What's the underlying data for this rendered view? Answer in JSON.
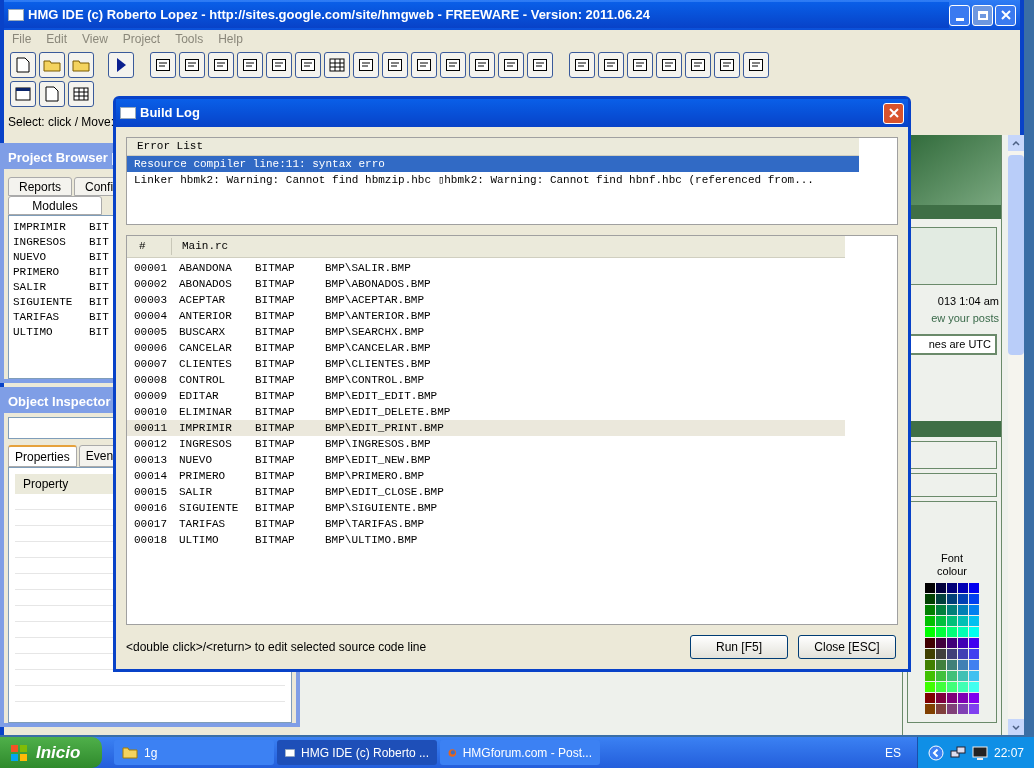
{
  "ide": {
    "title": "HMG IDE (c) Roberto Lopez - http://sites.google.com/site/hmgweb - FREEWARE - Version: 2011.06.24",
    "menu": [
      "File",
      "Edit",
      "View",
      "Project",
      "Tools",
      "Help"
    ],
    "status": "Select: click / Move:"
  },
  "project_browser": {
    "title": "Project Browser |",
    "tabs": [
      {
        "label": "Reports",
        "selected": false
      },
      {
        "label": "Confi",
        "selected": false
      },
      {
        "label": "Modules",
        "selected": true
      }
    ],
    "items": [
      {
        "name": "IMPRIMIR",
        "type": "BIT"
      },
      {
        "name": "INGRESOS",
        "type": "BIT"
      },
      {
        "name": "NUEVO",
        "type": "BIT"
      },
      {
        "name": "PRIMERO",
        "type": "BIT"
      },
      {
        "name": "SALIR",
        "type": "BIT"
      },
      {
        "name": "SIGUIENTE",
        "type": "BIT"
      },
      {
        "name": "TARIFAS",
        "type": "BIT"
      },
      {
        "name": "ULTIMO",
        "type": "BIT"
      }
    ]
  },
  "object_inspector": {
    "title": "Object Inspector",
    "tabs": [
      {
        "label": "Properties",
        "selected": true
      },
      {
        "label": "Even",
        "selected": false
      }
    ],
    "columns": [
      "Property"
    ]
  },
  "browser": {
    "date": "013 1:04 am",
    "link": "ew your posts",
    "timezone": "nes are UTC",
    "font_label": "Font colour"
  },
  "build_log": {
    "title": "Build Log",
    "error_list": {
      "header": "Error List",
      "rows": [
        {
          "text": "Resource compiler line:11: syntax erro",
          "selected": true
        },
        {
          "text": "Linker hbmk2: Warning: Cannot find hbmzip.hbc ▯hbmk2: Warning: Cannot find hbnf.hbc (referenced from...",
          "selected": false
        }
      ]
    },
    "source": {
      "columns": [
        "#",
        "Main.rc"
      ],
      "rows": [
        {
          "line": "00001",
          "name": "ABANDONA",
          "type": "BITMAP",
          "path": "BMP\\SALIR.BMP",
          "selected": false
        },
        {
          "line": "00002",
          "name": "ABONADOS",
          "type": "BITMAP",
          "path": "BMP\\ABONADOS.BMP",
          "selected": false
        },
        {
          "line": "00003",
          "name": "ACEPTAR",
          "type": "BITMAP",
          "path": "BMP\\ACEPTAR.BMP",
          "selected": false
        },
        {
          "line": "00004",
          "name": "ANTERIOR",
          "type": "BITMAP",
          "path": "BMP\\ANTERIOR.BMP",
          "selected": false
        },
        {
          "line": "00005",
          "name": "BUSCARX",
          "type": "BITMAP",
          "path": "BMP\\SEARCHX.BMP",
          "selected": false
        },
        {
          "line": "00006",
          "name": "CANCELAR",
          "type": "BITMAP",
          "path": "BMP\\CANCELAR.BMP",
          "selected": false
        },
        {
          "line": "00007",
          "name": "CLIENTES",
          "type": "BITMAP",
          "path": "BMP\\CLIENTES.BMP",
          "selected": false
        },
        {
          "line": "00008",
          "name": "CONTROL",
          "type": "BITMAP",
          "path": "BMP\\CONTROL.BMP",
          "selected": false
        },
        {
          "line": "00009",
          "name": "EDITAR",
          "type": "BITMAP",
          "path": "BMP\\EDIT_EDIT.BMP",
          "selected": false
        },
        {
          "line": "00010",
          "name": "ELIMINAR",
          "type": "BITMAP",
          "path": "BMP\\EDIT_DELETE.BMP",
          "selected": false
        },
        {
          "line": "00011",
          "name": "IMPRIMIR",
          "type": "BITMAP",
          "path": "BMP\\EDIT_PRINT.BMP",
          "selected": true
        },
        {
          "line": "00012",
          "name": "INGRESOS",
          "type": "BITMAP",
          "path": "BMP\\INGRESOS.BMP",
          "selected": false
        },
        {
          "line": "00013",
          "name": "NUEVO",
          "type": "BITMAP",
          "path": "BMP\\EDIT_NEW.BMP",
          "selected": false
        },
        {
          "line": "00014",
          "name": "PRIMERO",
          "type": "BITMAP",
          "path": "BMP\\PRIMERO.BMP",
          "selected": false
        },
        {
          "line": "00015",
          "name": "SALIR",
          "type": "BITMAP",
          "path": "BMP\\EDIT_CLOSE.BMP",
          "selected": false
        },
        {
          "line": "00016",
          "name": "SIGUIENTE",
          "type": "BITMAP",
          "path": "BMP\\SIGUIENTE.BMP",
          "selected": false
        },
        {
          "line": "00017",
          "name": "TARIFAS",
          "type": "BITMAP",
          "path": "BMP\\TARIFAS.BMP",
          "selected": false
        },
        {
          "line": "00018",
          "name": "ULTIMO",
          "type": "BITMAP",
          "path": "BMP\\ULTIMO.BMP",
          "selected": false
        }
      ]
    },
    "hint": "<double click>/<return> to edit selected source code line",
    "buttons": [
      "Run [F5]",
      "Close [ESC]"
    ]
  },
  "taskbar": {
    "start": "Inicio",
    "tasks": [
      {
        "label": "1g",
        "kind": "folder",
        "selected": false
      },
      {
        "label": "HMG IDE (c) Roberto ...",
        "kind": "window",
        "selected": true
      },
      {
        "label": "HMGforum.com - Post...",
        "kind": "browser",
        "selected": false
      }
    ],
    "language": "ES",
    "clock": "22:07"
  }
}
